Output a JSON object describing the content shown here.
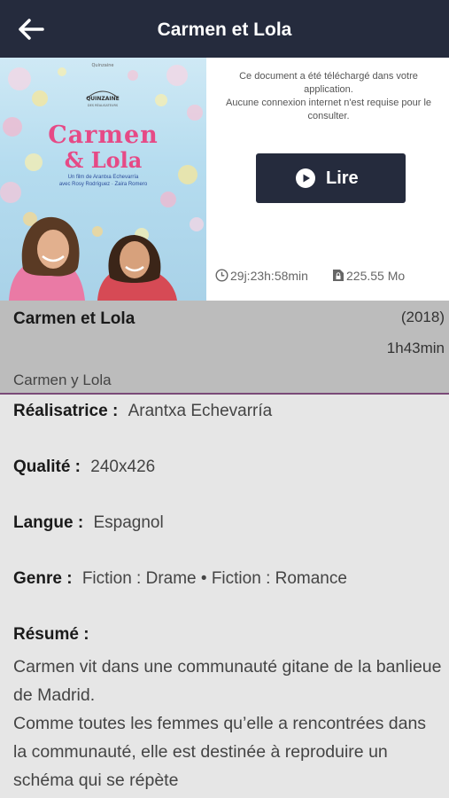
{
  "header": {
    "title": "Carmen et Lola",
    "back_icon": "arrow-left-icon"
  },
  "poster": {
    "title_line1": "Carmen",
    "title_line2": "& Lola",
    "credit1": "Un film de Arantxa Echevarría",
    "credit2": "avec Rosy Rodríguez · Zaira Romero"
  },
  "download_info": {
    "line1": "Ce document a été téléchargé dans votre application.",
    "line2": "Aucune connexion internet n'est requise pour le consulter."
  },
  "read_button": {
    "label": "Lire",
    "icon": "play-circle-icon"
  },
  "meta": {
    "duration_left": "29j:23h:58min",
    "duration_icon": "clock-icon",
    "file_size": "225.55 Mo",
    "file_icon": "file-lock-icon"
  },
  "movie": {
    "title": "Carmen et Lola",
    "year": "(2018)",
    "duration": "1h43min",
    "original_title": "Carmen y Lola"
  },
  "details": {
    "director_label": "Réalisatrice :",
    "director": "Arantxa Echevarría",
    "quality_label": "Qualité :",
    "quality": "240x426",
    "language_label": "Langue :",
    "language": "Espagnol",
    "genre_label": "Genre :",
    "genre": "Fiction : Drame • Fiction : Romance"
  },
  "summary": {
    "label": "Résumé :",
    "text": "Carmen vit dans une communauté gitane de la banlieue de Madrid.\nComme toutes les femmes qu’elle a rencontrées dans la communauté, elle est destinée à reproduire un schéma qui se répète"
  }
}
